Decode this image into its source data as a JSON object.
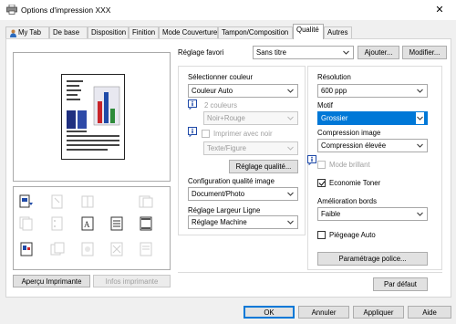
{
  "window": {
    "title": "Options d'impression XXX",
    "close_symbol": "✕"
  },
  "tabs": [
    "My Tab",
    "De base",
    "Disposition",
    "Finition",
    "Mode Couverture",
    "Tampon/Composition",
    "Qualité",
    "Autres"
  ],
  "active_tab": "Qualité",
  "favorite": {
    "label": "Réglage favori",
    "value": "Sans titre",
    "add_button": "Ajouter...",
    "modify_button": "Modifier..."
  },
  "preview": {
    "apercu_button": "Aperçu Imprimante",
    "infos_button": "Infos imprimante"
  },
  "color_section": {
    "select_color_label": "Sélectionner couleur",
    "select_color_value": "Couleur Auto",
    "two_colors_label": "2 couleurs",
    "two_colors_value": "Noir+Rouge",
    "print_black_label": "Imprimer avec noir",
    "text_figure_value": "Texte/Figure",
    "quality_settings_button": "Réglage qualité...",
    "quality_config_label": "Configuration qualité image",
    "quality_config_value": "Document/Photo",
    "line_width_label": "Réglage Largeur Ligne",
    "line_width_value": "Réglage Machine"
  },
  "right_section": {
    "resolution_label": "Résolution",
    "resolution_value": "600 ppp",
    "pattern_label": "Motif",
    "pattern_value": "Grossier",
    "compression_label": "Compression image",
    "compression_value": "Compression élevée",
    "glossy_label": "Mode brillant",
    "toner_save_label": "Economie Toner",
    "toner_save_checked": true,
    "edge_label": "Amélioration bords",
    "edge_value": "Faible",
    "trapping_label": "Piégeage Auto",
    "trapping_checked": false,
    "font_settings_button": "Paramétrage police..."
  },
  "default_button": "Par défaut",
  "footer": {
    "ok": "OK",
    "cancel": "Annuler",
    "apply": "Appliquer",
    "help": "Aide"
  },
  "colors": {
    "accent": "#0078d7",
    "bar_red": "#c8252a",
    "bar_blue": "#1f4aa8",
    "bar_green": "#2e8b3a",
    "bar_navy": "#1f2f80"
  }
}
